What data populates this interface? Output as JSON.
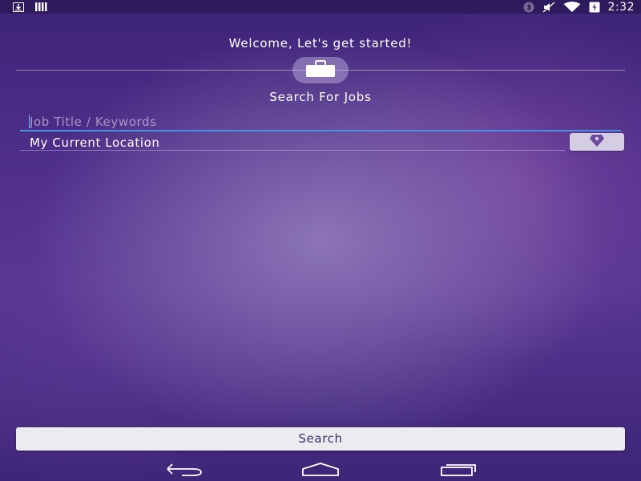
{
  "status_bar": {
    "left_icons": [
      "download-icon",
      "signal-bars-icon"
    ],
    "right_icons": [
      "bluetooth-icon",
      "mute-icon",
      "wifi-icon",
      "battery-charging-icon"
    ],
    "time": "2:32"
  },
  "header": {
    "welcome": "Welcome, Let's get started!",
    "badge_icon": "briefcase-icon",
    "section_title": "Search For Jobs"
  },
  "form": {
    "keyword_placeholder": "Job Title / Keywords",
    "keyword_value": "",
    "location_value": "My Current Location",
    "locate_icon": "location-pin-icon",
    "search_label": "Search"
  },
  "nav_bar": {
    "icons": [
      "back-icon",
      "home-icon",
      "recents-icon"
    ]
  },
  "colors": {
    "accent_focus": "#4c8fe0",
    "button_bg": "#ecebef",
    "button_text": "#3f2f6b",
    "pin_color": "#6a4a9a"
  }
}
